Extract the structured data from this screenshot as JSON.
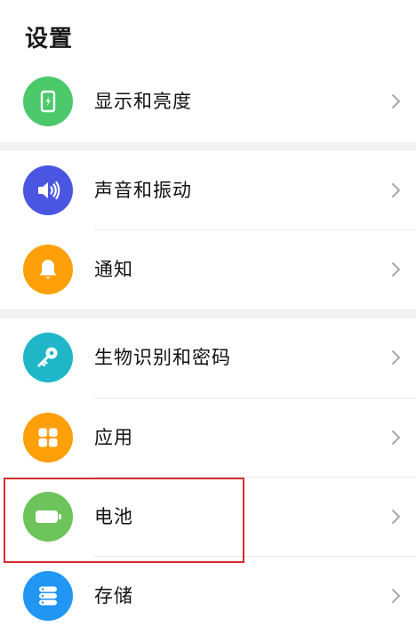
{
  "header": {
    "title": "设置"
  },
  "settings": {
    "items": [
      {
        "label": "显示和亮度",
        "icon": "phone-display-icon",
        "color": "#4cc96b"
      },
      {
        "label": "声音和振动",
        "icon": "speaker-icon",
        "color": "#4a56e2"
      },
      {
        "label": "通知",
        "icon": "bell-icon",
        "color": "#ff9f0a"
      },
      {
        "label": "生物识别和密码",
        "icon": "key-icon",
        "color": "#1fb6c8"
      },
      {
        "label": "应用",
        "icon": "apps-grid-icon",
        "color": "#ff9f0a"
      },
      {
        "label": "电池",
        "icon": "battery-icon",
        "color": "#6cc45a"
      },
      {
        "label": "存储",
        "icon": "storage-icon",
        "color": "#2196f3"
      }
    ]
  },
  "annotation": {
    "highlight_color": "#d32f2f",
    "highlighted_item": "电池"
  }
}
